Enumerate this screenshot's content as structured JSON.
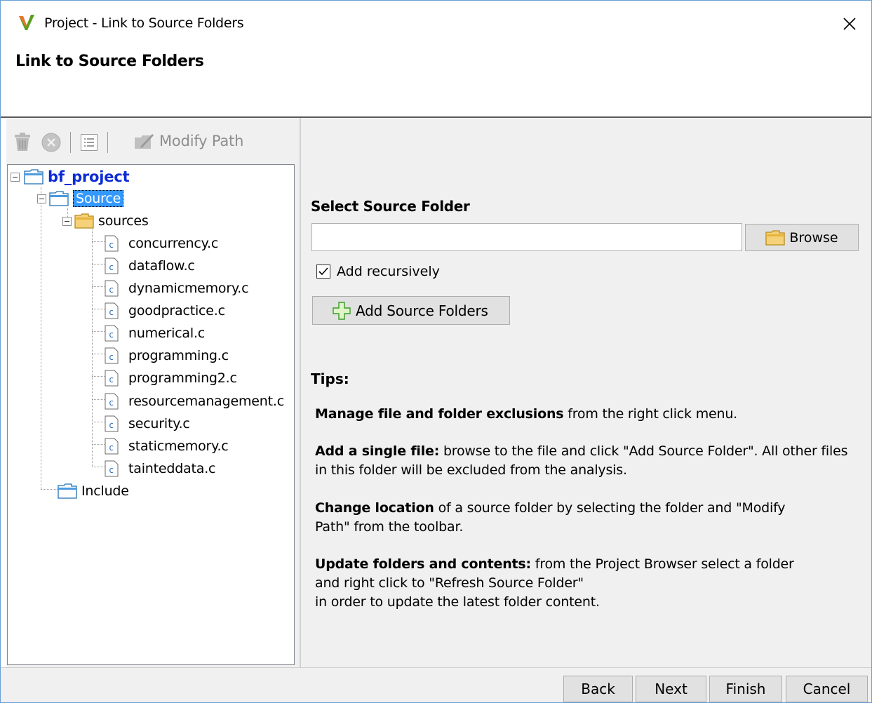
{
  "window": {
    "title": "Project - Link to Source Folders",
    "close_icon": "close-icon"
  },
  "header": {
    "title": "Link to Source Folders"
  },
  "toolbar": {
    "delete_icon": "trash-icon",
    "remove_icon": "remove-circle-icon",
    "list_icon": "list-icon",
    "modify_icon": "modify-path-icon",
    "modify_label": "Modify Path"
  },
  "tree": {
    "root": "bf_project",
    "source": "Source",
    "sources": "sources",
    "files": [
      "concurrency.c",
      "dataflow.c",
      "dynamicmemory.c",
      "goodpractice.c",
      "numerical.c",
      "programming.c",
      "programming2.c",
      "resourcemanagement.c",
      "security.c",
      "staticmemory.c",
      "tainteddata.c"
    ],
    "include": "Include",
    "scroll_left": "<",
    "scroll_right": ">"
  },
  "right": {
    "select_title": "Select Source Folder",
    "folder_value": "",
    "browse_label": "Browse",
    "recursive_label": "Add recursively",
    "recursive_checked": true,
    "add_label": "Add Source Folders",
    "tips_title": "Tips:",
    "tip1_bold": "Manage file and folder exclusions",
    "tip1_rest": " from the right click menu.",
    "tip2_bold": "Add a single file:",
    "tip2_rest": " browse to the file and click \"Add Source Folder\". All other files in this folder will be excluded from the analysis.",
    "tip3_bold": "Change location",
    "tip3_rest": " of a source folder by selecting the folder and \"Modify Path\" from the toolbar.",
    "tip4_bold": "Update folders and contents:",
    "tip4_line1": " from the Project Browser select a folder",
    "tip4_line2": "and right click to \"Refresh Source Folder\"",
    "tip4_line3": "in order to update the latest folder content."
  },
  "footer": {
    "back": "Back",
    "next": "Next",
    "finish": "Finish",
    "cancel": "Cancel"
  },
  "colors": {
    "accent_blue": "#0b2bd6",
    "selection": "#3399ff",
    "logo_green": "#5a9e1e"
  }
}
